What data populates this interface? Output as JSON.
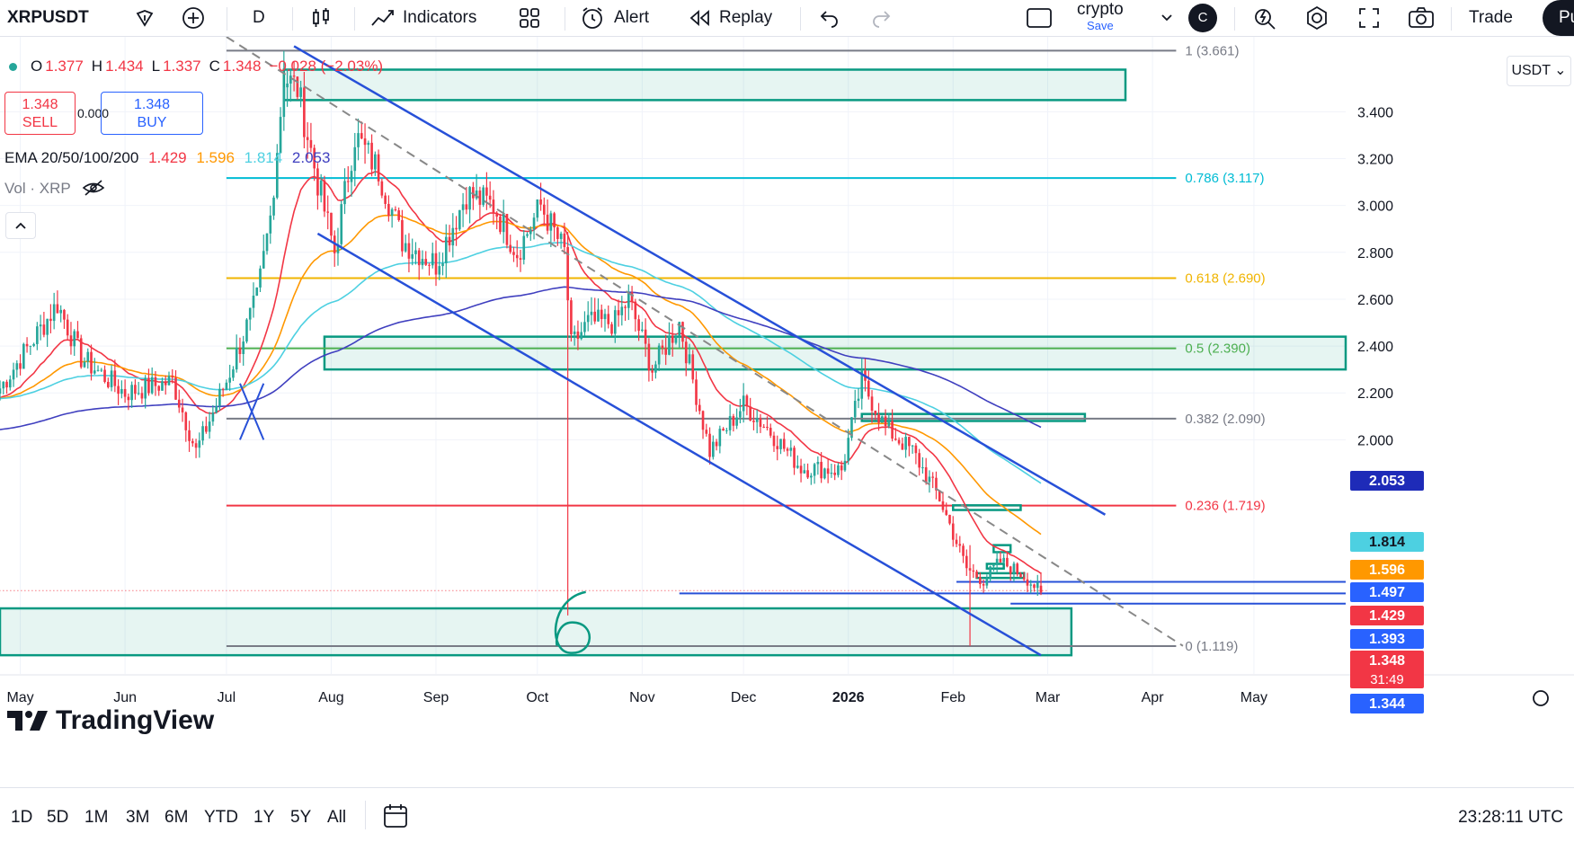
{
  "toolbar": {
    "symbol": "XRPUSDT",
    "interval": "D",
    "indicators_label": "Indicators",
    "alert_label": "Alert",
    "replay_label": "Replay",
    "layout_name": "crypto",
    "layout_save": "Save",
    "avatar_letter": "C",
    "trade_label": "Trade",
    "publish_label": "Pu"
  },
  "legend": {
    "o_key": "O",
    "o_val": "1.377",
    "h_key": "H",
    "h_val": "1.434",
    "l_key": "L",
    "l_val": "1.337",
    "c_key": "C",
    "c_val": "1.348",
    "change": "−0.028 (−2.03%)",
    "sell_price": "1.348",
    "sell_label": "SELL",
    "spread": "0.000",
    "buy_price": "1.348",
    "buy_label": "BUY",
    "ema_label": "EMA 20/50/100/200",
    "ema20": "1.429",
    "ema50": "1.596",
    "ema100": "1.814",
    "ema200": "2.053",
    "vol_label": "Vol · XRP"
  },
  "currency_label": "USDT",
  "brand": "TradingView",
  "colors": {
    "up": "#26a69a",
    "down": "#f23645",
    "ema20": "#f23645",
    "ema50": "#ff9800",
    "ema100": "#4dd0e1",
    "ema200": "#3f3fbf",
    "channel": "#2750d8",
    "box": "#089981"
  },
  "chart_data": {
    "type": "candlestick",
    "symbol": "XRPUSDT",
    "interval": "1D",
    "y_axis": {
      "min": 1.0,
      "max": 3.72,
      "ticks": [
        2.0,
        2.2,
        2.4,
        2.6,
        2.8,
        3.0,
        3.2,
        3.4
      ]
    },
    "x_axis": {
      "labels": [
        "May",
        "Jun",
        "Jul",
        "Aug",
        "Sep",
        "Oct",
        "Nov",
        "Dec",
        "2026",
        "Feb",
        "Mar",
        "Apr",
        "May"
      ],
      "start_date": "2025-04-25",
      "end_date": "2026-05-13"
    },
    "last_candle": {
      "date": "2026-02-27",
      "open": 1.377,
      "high": 1.434,
      "low": 1.337,
      "close": 1.348
    },
    "anchors": [
      [
        "2025-04-25",
        2.22
      ],
      [
        "2025-05-12",
        2.58
      ],
      [
        "2025-05-19",
        2.35
      ],
      [
        "2025-06-01",
        2.2
      ],
      [
        "2025-06-15",
        2.25
      ],
      [
        "2025-06-22",
        1.95
      ],
      [
        "2025-07-01",
        2.25
      ],
      [
        "2025-07-10",
        2.6
      ],
      [
        "2025-07-14",
        2.95
      ],
      [
        "2025-07-18",
        3.55
      ],
      [
        "2025-07-22",
        3.5
      ],
      [
        "2025-07-28",
        3.1
      ],
      [
        "2025-08-02",
        2.8
      ],
      [
        "2025-08-08",
        3.3
      ],
      [
        "2025-08-15",
        3.15
      ],
      [
        "2025-08-22",
        2.85
      ],
      [
        "2025-09-01",
        2.75
      ],
      [
        "2025-09-10",
        3.05
      ],
      [
        "2025-09-18",
        3.0
      ],
      [
        "2025-09-25",
        2.8
      ],
      [
        "2025-10-02",
        3.0
      ],
      [
        "2025-10-09",
        2.8
      ],
      [
        "2025-10-11",
        2.4
      ],
      [
        "2025-10-16",
        2.5
      ],
      [
        "2025-10-24",
        2.5
      ],
      [
        "2025-10-28",
        2.6
      ],
      [
        "2025-11-04",
        2.3
      ],
      [
        "2025-11-12",
        2.5
      ],
      [
        "2025-11-21",
        1.95
      ],
      [
        "2025-12-01",
        2.15
      ],
      [
        "2025-12-08",
        2.05
      ],
      [
        "2025-12-18",
        1.88
      ],
      [
        "2025-12-30",
        1.87
      ],
      [
        "2026-01-05",
        2.25
      ],
      [
        "2026-01-12",
        2.05
      ],
      [
        "2026-01-20",
        1.95
      ],
      [
        "2026-01-28",
        1.75
      ],
      [
        "2026-02-05",
        1.45
      ],
      [
        "2026-02-10",
        1.4
      ],
      [
        "2026-02-15",
        1.48
      ],
      [
        "2026-02-22",
        1.42
      ],
      [
        "2026-02-27",
        1.348
      ]
    ],
    "wicks": [
      {
        "date": "2025-10-10",
        "low": 1.25,
        "high": 2.55
      },
      {
        "date": "2026-02-06",
        "low": 1.12,
        "high": 1.55
      },
      {
        "date": "2025-07-18",
        "low": 3.4,
        "high": 3.66
      }
    ],
    "ema_series": [
      {
        "name": "EMA 20",
        "last": 1.429
      },
      {
        "name": "EMA 50",
        "last": 1.596
      },
      {
        "name": "EMA 100",
        "last": 1.814
      },
      {
        "name": "EMA 200",
        "last": 2.053
      }
    ],
    "fib_levels": [
      {
        "ratio": "1",
        "price": 3.661,
        "label": "1 (3.661)",
        "color": "#787b86"
      },
      {
        "ratio": "0.786",
        "price": 3.117,
        "label": "0.786 (3.117)",
        "color": "#00bcd4"
      },
      {
        "ratio": "0.618",
        "price": 2.69,
        "label": "0.618 (2.690)",
        "color": "#f0b400"
      },
      {
        "ratio": "0.5",
        "price": 2.39,
        "label": "0.5 (2.390)",
        "color": "#4caf50"
      },
      {
        "ratio": "0.382",
        "price": 2.09,
        "label": "0.382 (2.090)",
        "color": "#787b86"
      },
      {
        "ratio": "0.236",
        "price": 1.719,
        "label": "0.236 (1.719)",
        "color": "#f23645"
      },
      {
        "ratio": "0",
        "price": 1.119,
        "label": "0 (1.119)",
        "color": "#787b86"
      }
    ],
    "horizontal_lines": [
      1.393,
      1.344,
      1.3
    ],
    "zones": [
      {
        "from": "2025-07-18",
        "to": "2026-03-24",
        "low": 3.45,
        "high": 3.58
      },
      {
        "from": "2025-07-30",
        "to": "2026-06-01",
        "low": 2.3,
        "high": 2.44
      },
      {
        "from": "2026-01-05",
        "to": "2026-03-12",
        "low": 2.08,
        "high": 2.11
      },
      {
        "from": "2025-04-25",
        "to": "2026-03-08",
        "low": 1.08,
        "high": 1.28
      }
    ],
    "channel_upper": [
      [
        "2025-07-21",
        3.68
      ],
      [
        "2026-03-18",
        1.68
      ]
    ],
    "channel_lower": [
      [
        "2025-07-28",
        2.88
      ],
      [
        "2026-02-27",
        1.08
      ]
    ],
    "dashed_trend": [
      [
        "2025-07-01",
        3.72
      ],
      [
        "2026-04-10",
        1.12
      ]
    ],
    "price_tags": [
      {
        "value": "2.053",
        "color": "#1e2bb8"
      },
      {
        "value": "1.814",
        "color": "#4dd0e1"
      },
      {
        "value": "1.596",
        "color": "#ff9800"
      },
      {
        "value": "1.497",
        "color": "#2962ff"
      },
      {
        "value": "1.429",
        "color": "#f23645"
      },
      {
        "value": "1.393",
        "color": "#2962ff"
      },
      {
        "value": "1.348",
        "color": "#f23645",
        "sub": "31:49"
      },
      {
        "value": "1.344",
        "color": "#2962ff"
      }
    ],
    "annotation": "6"
  },
  "bottom": {
    "ranges": [
      "1D",
      "5D",
      "1M",
      "3M",
      "6M",
      "YTD",
      "1Y",
      "5Y",
      "All"
    ],
    "clock": "23:28:11 UTC"
  }
}
